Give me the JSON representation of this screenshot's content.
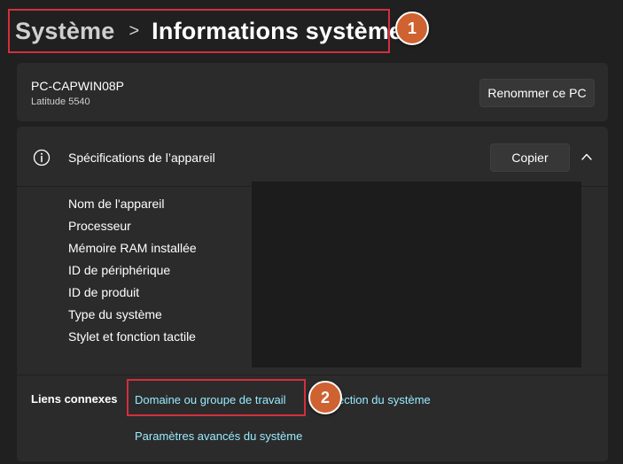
{
  "breadcrumb": {
    "parent": "Système",
    "separator": ">",
    "current": "Informations système"
  },
  "annotations": {
    "step1": "1",
    "step2": "2"
  },
  "device_card": {
    "pc_name": "PC-CAPWIN08P",
    "model": "Latitude 5540",
    "rename_button": "Renommer ce PC"
  },
  "specs": {
    "title": "Spécifications de l’appareil",
    "copy_button": "Copier",
    "rows": [
      "Nom de l'appareil",
      "Processeur",
      "Mémoire RAM installée",
      "ID de périphérique",
      "ID de produit",
      "Type du système",
      "Stylet et fonction tactile"
    ]
  },
  "related_links": {
    "title": "Liens connexes",
    "domain": "Domaine ou groupe de travail",
    "protection": "ection du système",
    "advanced": "Paramètres avancés du système"
  },
  "colors": {
    "background": "#202020",
    "card": "#2b2b2b",
    "link": "#99ebff",
    "highlight": "#d32f3c",
    "badge": "#cf6231"
  },
  "icons": [
    "info-icon",
    "chevron-right-icon",
    "chevron-up-icon"
  ]
}
